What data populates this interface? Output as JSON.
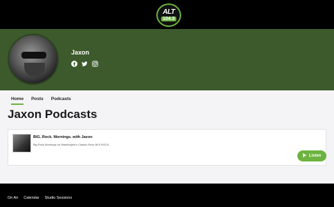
{
  "header": {
    "logo": {
      "line1": "ALT",
      "line2": "104.5"
    }
  },
  "hero": {
    "host_name": "Jaxon",
    "socials": [
      {
        "icon": "facebook-icon"
      },
      {
        "icon": "twitter-icon"
      },
      {
        "icon": "instagram-icon"
      }
    ]
  },
  "tabs": [
    "Home",
    "Posts",
    "Podcasts"
  ],
  "page_title": "Jaxon Podcasts",
  "podcast": {
    "title": "BIG. Rock. Mornings. with Jaxon",
    "description": "Big Rock Mornings on Washington's Classic Rock 98.5 ROCK",
    "listen_label": "Listen"
  },
  "footer": {
    "links": [
      "On Air",
      "Calendar",
      "Studio Sessions"
    ]
  },
  "colors": {
    "accent": "#6cb33f",
    "hero_bg": "#3c5a2c"
  }
}
